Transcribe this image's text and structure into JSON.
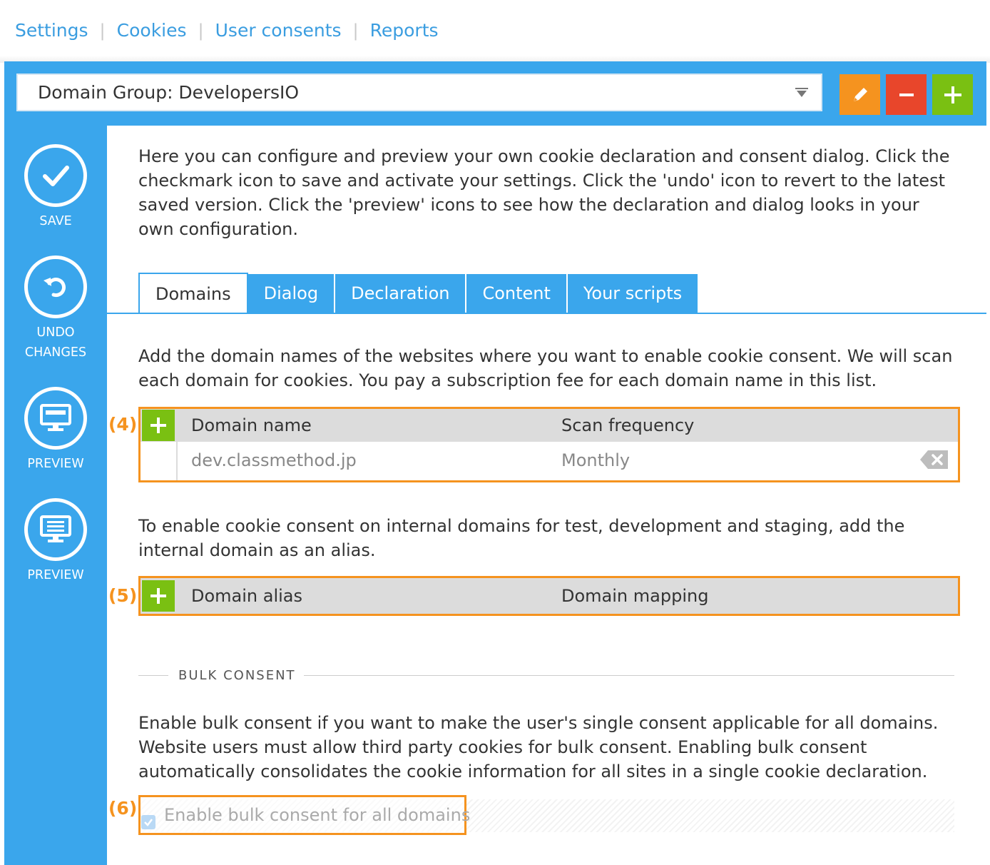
{
  "topnav": {
    "items": [
      "Settings",
      "Cookies",
      "User consents",
      "Reports"
    ],
    "separator": "|"
  },
  "domain_group": {
    "label": "Domain Group: DevelopersIO"
  },
  "toolbar": {
    "edit_icon": "pencil-icon",
    "remove_icon": "minus-icon",
    "add_icon": "plus-icon"
  },
  "sidebar": {
    "save": "SAVE",
    "undo_line1": "UNDO",
    "undo_line2": "CHANGES",
    "preview1": "PREVIEW",
    "preview2": "PREVIEW"
  },
  "intro": "Here you can configure and preview your own cookie declaration and consent dialog. Click the checkmark icon to save and activate your settings. Click the 'undo' icon to revert to the latest saved version. Click the 'preview' icons to see how the declaration and dialog looks in your own configuration.",
  "tabs": [
    "Domains",
    "Dialog",
    "Declaration",
    "Content",
    "Your scripts"
  ],
  "domains": {
    "description": "Add the domain names of the websites where you want to enable cookie consent. We will scan each domain for cookies. You pay a subscription fee for each domain name in this list.",
    "callout": "(4)",
    "col_name": "Domain name",
    "col_freq": "Scan frequency",
    "rows": [
      {
        "name": "dev.classmethod.jp",
        "freq": "Monthly"
      }
    ]
  },
  "aliases": {
    "description": "To enable cookie consent on internal domains for test, development and staging, add the internal domain as an alias.",
    "callout": "(5)",
    "col_alias": "Domain alias",
    "col_mapping": "Domain mapping"
  },
  "bulk": {
    "heading": "BULK CONSENT",
    "description": "Enable bulk consent if you want to make the user's single consent applicable for all domains. Website users must allow third party cookies for bulk consent. Enabling bulk consent automatically consolidates the cookie information for all sites in a single cookie declaration.",
    "callout": "(6)",
    "checkbox_label": "Enable bulk consent for all domains",
    "checked": true
  },
  "colors": {
    "accent": "#3aa6ec",
    "highlight": "#f5931f",
    "add": "#7ac012",
    "remove": "#e8462b",
    "edit": "#f5931f"
  }
}
